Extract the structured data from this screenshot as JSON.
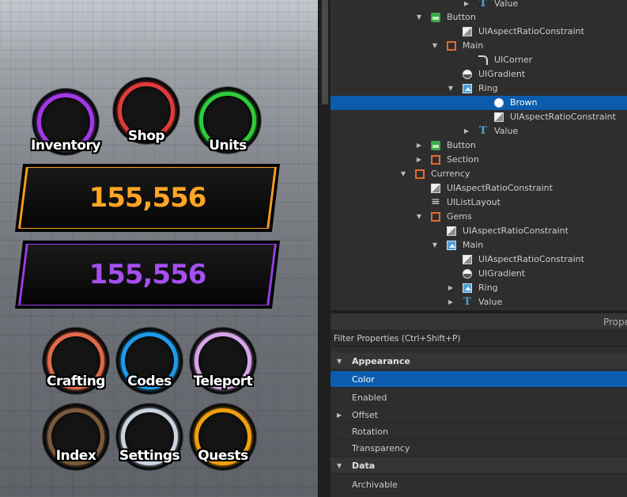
{
  "hud": {
    "top_buttons": [
      {
        "label": "Inventory",
        "ring_color": "#a238e8"
      },
      {
        "label": "Shop",
        "ring_color": "#e03b3b"
      },
      {
        "label": "Units",
        "ring_color": "#2fcc3a"
      }
    ],
    "currency_bars": [
      {
        "value": "155,556",
        "color": "#ff9f1c",
        "text_color": "#ffa526"
      },
      {
        "value": "155,556",
        "color": "#9a3ee8",
        "text_color": "#a64ef0"
      }
    ],
    "bottom_buttons": [
      {
        "label": "Crafting",
        "ring_color": "#e2694a"
      },
      {
        "label": "Codes",
        "ring_color": "#1e9be8"
      },
      {
        "label": "Teleport",
        "ring_color": "#d8a6e8"
      },
      {
        "label": "Index",
        "ring_color": "#7a5a3c"
      },
      {
        "label": "Settings",
        "ring_color": "#c9d3e0"
      },
      {
        "label": "Quests",
        "ring_color": "#f0a010"
      }
    ]
  },
  "explorer": {
    "rows": [
      {
        "label": "Value",
        "icon": "text-icon",
        "expand": "collapsed",
        "selected": false
      },
      {
        "label": "Button",
        "icon": "image-button-icon",
        "expand": "expanded",
        "selected": false
      },
      {
        "label": "UIAspectRatioConstraint",
        "icon": "aspect-ratio-icon",
        "expand": "none",
        "selected": false
      },
      {
        "label": "Main",
        "icon": "frame-icon",
        "expand": "expanded",
        "selected": false
      },
      {
        "label": "UICorner",
        "icon": "corner-icon",
        "expand": "none",
        "selected": false
      },
      {
        "label": "UIGradient",
        "icon": "gradient-icon",
        "expand": "none",
        "selected": false
      },
      {
        "label": "Ring",
        "icon": "image-icon",
        "expand": "expanded",
        "selected": false
      },
      {
        "label": "Brown",
        "icon": "color-icon",
        "expand": "none",
        "selected": true
      },
      {
        "label": "UIAspectRatioConstraint",
        "icon": "aspect-ratio-icon",
        "expand": "none",
        "selected": false
      },
      {
        "label": "Value",
        "icon": "text-icon",
        "expand": "collapsed",
        "selected": false
      },
      {
        "label": "Button",
        "icon": "image-button-icon",
        "expand": "collapsed",
        "selected": false
      },
      {
        "label": "Section",
        "icon": "frame-icon",
        "expand": "collapsed",
        "selected": false
      },
      {
        "label": "Currency",
        "icon": "frame-icon",
        "expand": "expanded",
        "selected": false
      },
      {
        "label": "UIAspectRatioConstraint",
        "icon": "aspect-ratio-icon",
        "expand": "none",
        "selected": false
      },
      {
        "label": "UIListLayout",
        "icon": "list-layout-icon",
        "expand": "none",
        "selected": false
      },
      {
        "label": "Gems",
        "icon": "frame-icon",
        "expand": "expanded",
        "selected": false
      },
      {
        "label": "UIAspectRatioConstraint",
        "icon": "aspect-ratio-icon",
        "expand": "none",
        "selected": false
      },
      {
        "label": "Main",
        "icon": "image-icon",
        "expand": "expanded",
        "selected": false
      },
      {
        "label": "UIAspectRatioConstraint",
        "icon": "aspect-ratio-icon",
        "expand": "none",
        "selected": false
      },
      {
        "label": "UIGradient",
        "icon": "gradient-icon",
        "expand": "none",
        "selected": false
      },
      {
        "label": "Ring",
        "icon": "image-icon",
        "expand": "collapsed",
        "selected": false
      },
      {
        "label": "Value",
        "icon": "text-icon",
        "expand": "collapsed",
        "selected": false
      }
    ]
  },
  "properties": {
    "title": "Prope",
    "filter_placeholder": "Filter Properties (Ctrl+Shift+P)",
    "rows": [
      {
        "label": "Appearance",
        "kind": "category",
        "expand": "expanded"
      },
      {
        "label": "Color",
        "kind": "property",
        "selected": true
      },
      {
        "label": "Enabled",
        "kind": "property"
      },
      {
        "label": "Offset",
        "kind": "property",
        "expand": "collapsed"
      },
      {
        "label": "Rotation",
        "kind": "property"
      },
      {
        "label": "Transparency",
        "kind": "property"
      },
      {
        "label": "Data",
        "kind": "category",
        "expand": "expanded"
      },
      {
        "label": "Archivable",
        "kind": "property"
      }
    ]
  }
}
